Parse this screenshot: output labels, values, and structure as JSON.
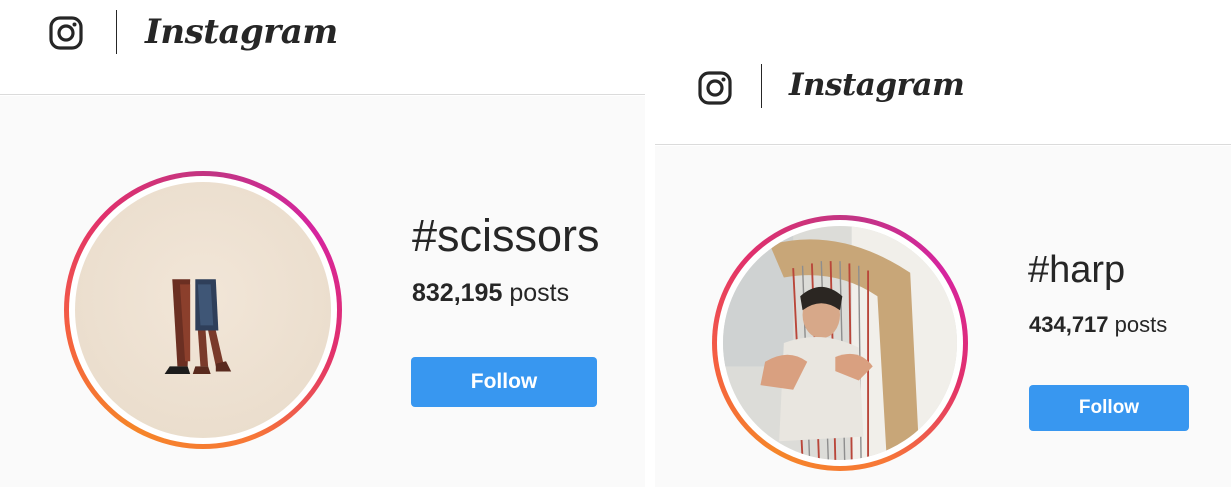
{
  "screens": [
    {
      "brand": {
        "wordmark": "Instagram",
        "icon": "instagram-camera-icon"
      },
      "hashtag": {
        "name": "#scissors",
        "post_count": "832,195",
        "post_suffix": " posts",
        "follow_label": "Follow",
        "avatar": "scissors-legs-photo"
      }
    },
    {
      "brand": {
        "wordmark": "Instagram",
        "icon": "instagram-camera-icon"
      },
      "hashtag": {
        "name": "#harp",
        "post_count": "434,717",
        "post_suffix": " posts",
        "follow_label": "Follow",
        "avatar": "harp-player-photo"
      }
    }
  ],
  "colors": {
    "follow_button": "#3897f0",
    "ring_gradient": [
      "#f58529",
      "#e1306c",
      "#c13584"
    ],
    "content_bg": "#fafafa",
    "text": "#262626"
  }
}
